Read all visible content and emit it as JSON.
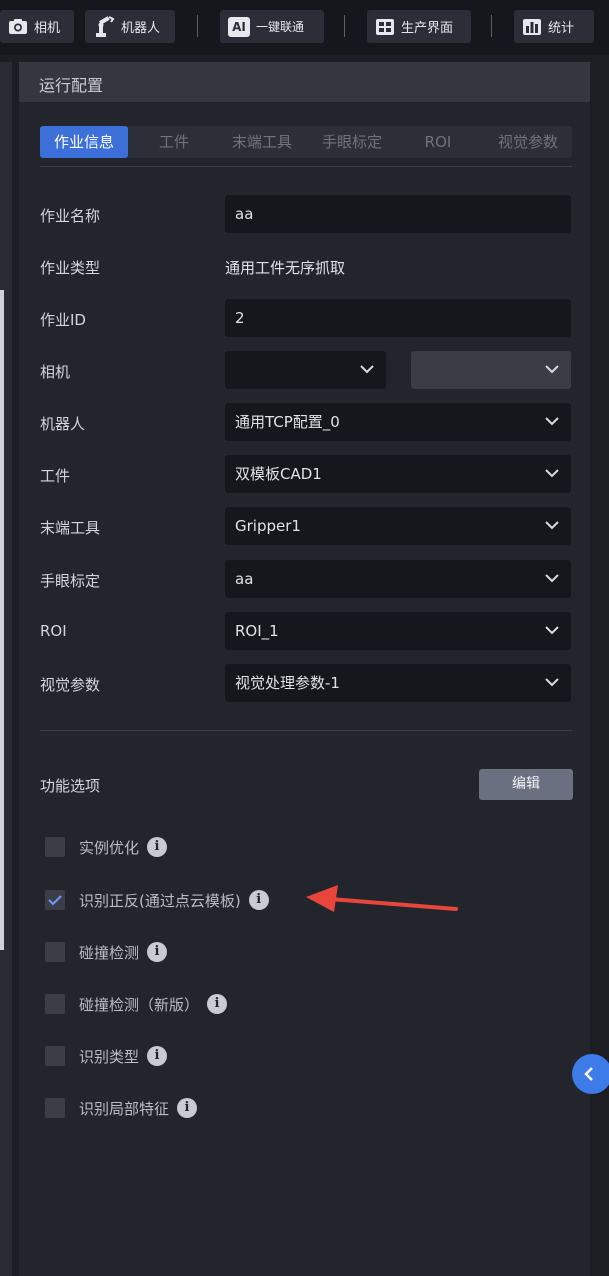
{
  "toolbar": {
    "camera_label": "相机",
    "robot_label": "机器人",
    "ai_badge": "AI",
    "oneclick_label": "一键联通",
    "production_label": "生产界面",
    "stats_label": "统计"
  },
  "panel": {
    "title": "运行配置",
    "tabs": [
      {
        "label": "作业信息",
        "active": true
      },
      {
        "label": "工件",
        "active": false
      },
      {
        "label": "末端工具",
        "active": false
      },
      {
        "label": "手眼标定",
        "active": false
      },
      {
        "label": "ROI",
        "active": false
      },
      {
        "label": "视觉参数",
        "active": false
      }
    ]
  },
  "form": {
    "job_name": {
      "label": "作业名称",
      "value": "aa"
    },
    "job_type": {
      "label": "作业类型",
      "value": "通用工件无序抓取"
    },
    "job_id": {
      "label": "作业ID",
      "value": "2"
    },
    "camera": {
      "label": "相机",
      "value": "",
      "value2": ""
    },
    "robot": {
      "label": "机器人",
      "value": "通用TCP配置_0"
    },
    "workpiece": {
      "label": "工件",
      "value": "双模板CAD1"
    },
    "end_tool": {
      "label": "末端工具",
      "value": "Gripper1"
    },
    "hand_eye": {
      "label": "手眼标定",
      "value": "aa"
    },
    "roi": {
      "label": "ROI",
      "value": "ROI_1"
    },
    "vision_params": {
      "label": "视觉参数",
      "value": "视觉处理参数-1"
    }
  },
  "features": {
    "title": "功能选项",
    "edit_label": "编辑",
    "options": [
      {
        "label": "实例优化",
        "checked": false
      },
      {
        "label": "识别正反(通过点云模板)",
        "checked": true
      },
      {
        "label": "碰撞检测",
        "checked": false
      },
      {
        "label": "碰撞检测（新版）",
        "checked": false
      },
      {
        "label": "识别类型",
        "checked": false
      },
      {
        "label": "识别局部特征",
        "checked": false
      }
    ],
    "info_glyph": "i"
  },
  "colors": {
    "accent": "#3d6fd9",
    "annotation_arrow": "#e8453c"
  },
  "icons": {
    "camera": "camera-icon",
    "robot": "robot-arm-icon",
    "production": "grid-icon",
    "stats": "bar-chart-icon",
    "chevron": "chevron-down-icon",
    "collapse": "chevron-left-icon"
  }
}
